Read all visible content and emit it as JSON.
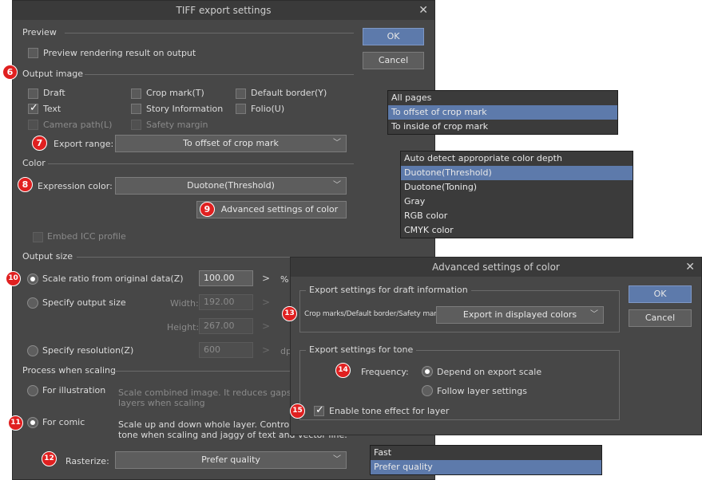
{
  "main_dialog": {
    "title": "TIFF export settings",
    "close": "✕",
    "ok": "OK",
    "cancel": "Cancel",
    "preview": {
      "section": "Preview",
      "preview_rendering": "Preview rendering result on output"
    },
    "output_image": {
      "section": "Output image",
      "draft": "Draft",
      "crop_mark": "Crop mark(T)",
      "default_border": "Default border(Y)",
      "text": "Text",
      "story_information": "Story Information",
      "folio": "Folio(U)",
      "camera_path": "Camera path(L)",
      "safety_margin": "Safety margin",
      "export_range_label": "Export range:",
      "export_range_value": "To offset of crop mark"
    },
    "color": {
      "section": "Color",
      "expression_color_label": "Expression color:",
      "expression_color_value": "Duotone(Threshold)",
      "advanced_button": "Advanced settings of color",
      "embed_icc": "Embed ICC profile"
    },
    "output_size": {
      "section": "Output size",
      "scale_ratio": "Scale ratio from original data(Z)",
      "scale_value": "100.00",
      "scale_unit": "%",
      "specify_output_size": "Specify output size",
      "width_label": "Width:",
      "width_value": "192.00",
      "height_label": "Height:",
      "height_value": "267.00",
      "specify_resolution": "Specify resolution(Z)",
      "resolution_value": "600",
      "resolution_unit": "dp",
      "arrow": ">"
    },
    "process_scaling": {
      "section": "Process when scaling",
      "for_illustration": "For illustration",
      "illustration_desc_1": "Scale combined image. It reduces gaps be",
      "illustration_desc_2": "layers when scaling",
      "for_comic": "For comic",
      "comic_desc_1": "Scale up and down whole layer. Control m",
      "comic_desc_2": "tone when scaling and jaggy of text and vector line.",
      "rasterize_label": "Rasterize:",
      "rasterize_value": "Prefer quality"
    }
  },
  "popups": {
    "export_range": [
      "All pages",
      "To offset of crop mark",
      "To inside of crop mark"
    ],
    "export_range_selected": 1,
    "expression_color": [
      "Auto detect appropriate color depth",
      "Duotone(Threshold)",
      "Duotone(Toning)",
      "Gray",
      "RGB color",
      "CMYK color"
    ],
    "expression_color_selected": 1,
    "rasterize": [
      "Fast",
      "Prefer quality"
    ],
    "rasterize_selected": 1
  },
  "advanced_dialog": {
    "title": "Advanced settings of color",
    "close": "✕",
    "ok": "OK",
    "cancel": "Cancel",
    "draft_group_title": "Export settings for draft information",
    "crop_marks_label": "Crop marks/Default border/Safety marg",
    "crop_marks_value": "Export in displayed colors",
    "tone_group_title": "Export settings for tone",
    "frequency_label": "Frequency:",
    "depend_on_scale": "Depend on export scale",
    "follow_layer": "Follow layer settings",
    "enable_tone": "Enable tone effect for layer"
  },
  "badges": [
    "6",
    "7",
    "8",
    "9",
    "10",
    "11",
    "12",
    "13",
    "14",
    "15"
  ],
  "colors": {
    "dialog_bg": "#474747",
    "accent": "#5d7aab",
    "badge": "#e02020",
    "connector": "#e02020"
  }
}
